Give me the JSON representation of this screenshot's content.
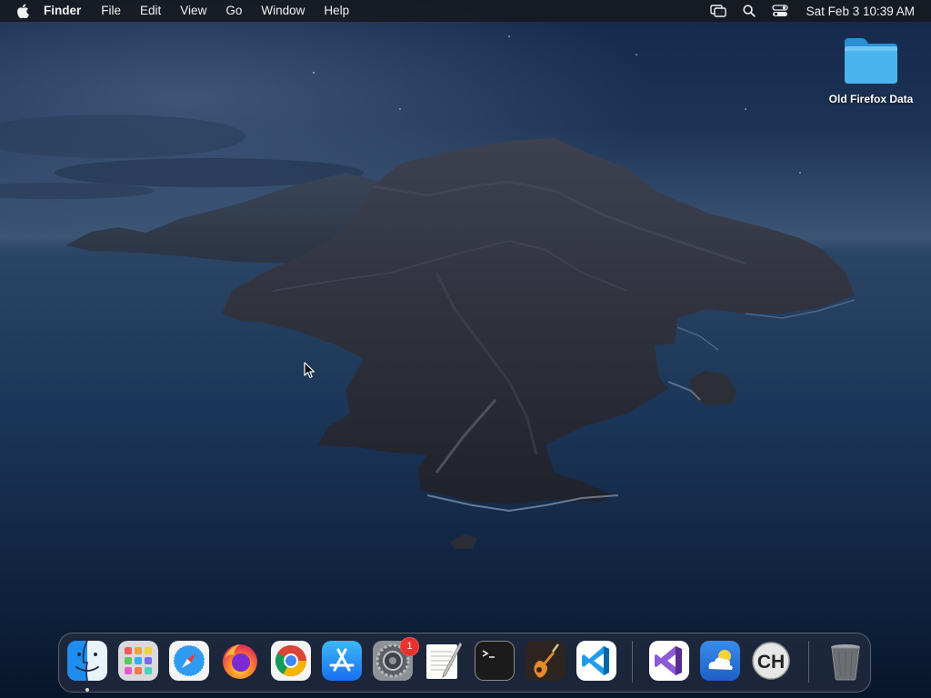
{
  "menubar": {
    "app_name": "Finder",
    "menus": [
      "File",
      "Edit",
      "View",
      "Go",
      "Window",
      "Help"
    ],
    "status_icons": [
      "screen-mirroring-icon",
      "spotlight-search-icon",
      "control-center-icon"
    ],
    "clock": "Sat Feb 3  10:39 AM"
  },
  "desktop": {
    "items": [
      {
        "label": "Old Firefox Data",
        "icon": "folder-icon"
      }
    ]
  },
  "dock": {
    "apps": [
      {
        "name": "Finder",
        "icon": "finder-icon",
        "running": true
      },
      {
        "name": "Launchpad",
        "icon": "launchpad-icon"
      },
      {
        "name": "Safari",
        "icon": "safari-icon"
      },
      {
        "name": "Firefox",
        "icon": "firefox-icon"
      },
      {
        "name": "Google Chrome",
        "icon": "chrome-icon"
      },
      {
        "name": "App Store",
        "icon": "app-store-icon"
      },
      {
        "name": "System Preferences",
        "icon": "system-preferences-icon",
        "badge": "1"
      },
      {
        "name": "TextEdit",
        "icon": "textedit-icon"
      },
      {
        "name": "Terminal",
        "icon": "terminal-icon"
      },
      {
        "name": "GarageBand",
        "icon": "garageband-icon"
      },
      {
        "name": "Visual Studio Code",
        "icon": "vscode-icon"
      }
    ],
    "recent_apps": [
      {
        "name": "Visual Studio",
        "icon": "visual-studio-icon"
      },
      {
        "name": "Weather",
        "icon": "weather-icon"
      },
      {
        "name": "CH",
        "icon": "ch-icon",
        "text": "CH"
      }
    ],
    "trash": {
      "name": "Trash",
      "icon": "trash-icon"
    },
    "colors": {
      "accent_badge": "#e8322e",
      "folder": "#3aa8e8"
    }
  }
}
